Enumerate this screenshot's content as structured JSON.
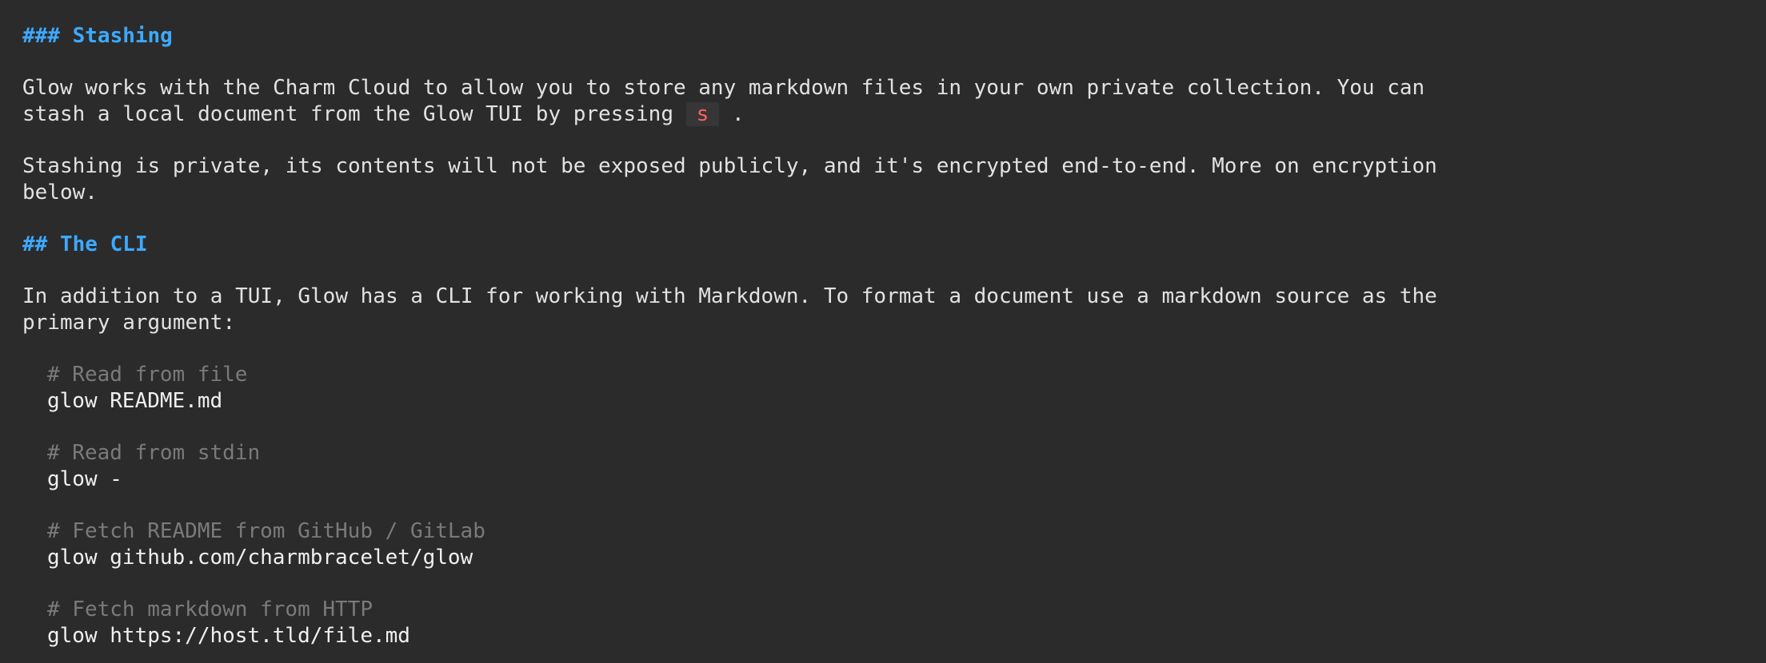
{
  "stashing": {
    "heading": "### Stashing",
    "para1_line1": "Glow works with the Charm Cloud to allow you to store any markdown files in your own private collection. You can",
    "para1_line2_before": "stash a local document from the Glow TUI by pressing ",
    "para1_key": "s",
    "para1_line2_after": " .",
    "para2_line1": "Stashing is private, its contents will not be exposed publicly, and it's encrypted end-to-end. More on encryption",
    "para2_line2": "below."
  },
  "cli": {
    "heading": "## The CLI",
    "para_line1": "In addition to a TUI, Glow has a CLI for working with Markdown. To format a document use a markdown source as the",
    "para_line2": "primary argument:",
    "examples": [
      {
        "comment": "# Read from file",
        "command": "glow README.md"
      },
      {
        "comment": "# Read from stdin",
        "command": "glow -"
      },
      {
        "comment": "# Fetch README from GitHub / GitLab",
        "command": "glow github.com/charmbracelet/glow"
      },
      {
        "comment": "# Fetch markdown from HTTP",
        "command": "glow https://host.tld/file.md"
      }
    ]
  }
}
